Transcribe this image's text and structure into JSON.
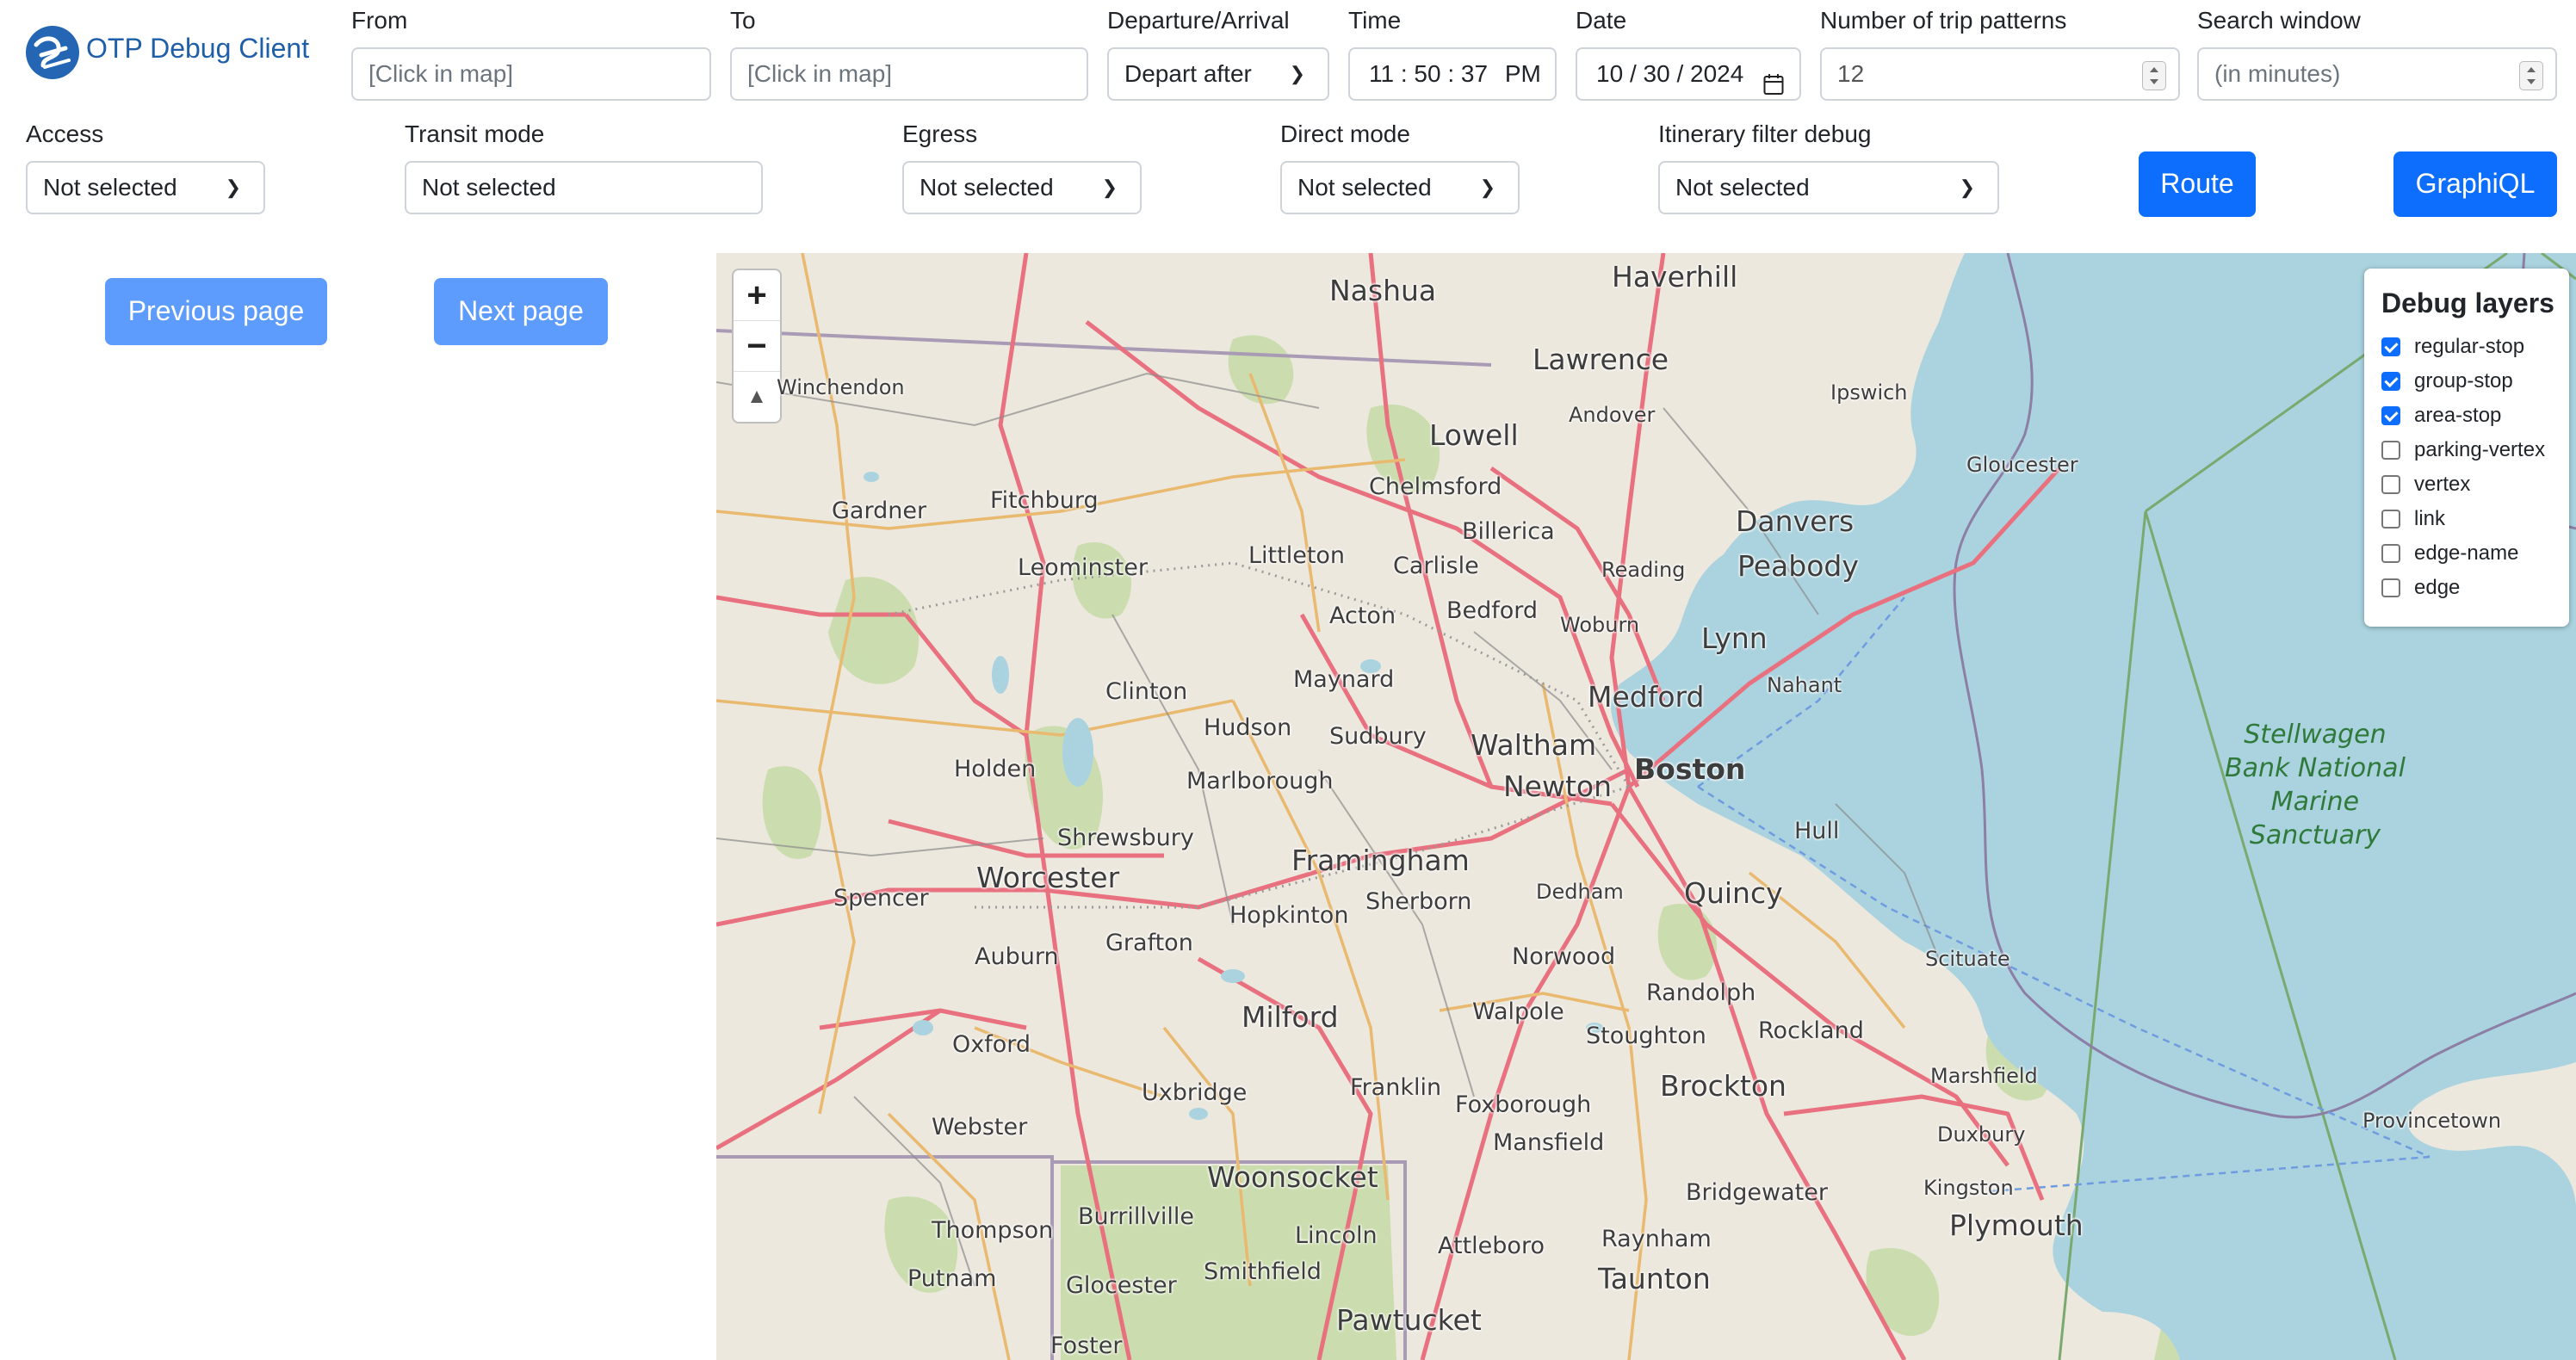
{
  "app": {
    "title": "OTP Debug Client"
  },
  "form": {
    "from": {
      "label": "From",
      "placeholder": "[Click in map]"
    },
    "to": {
      "label": "To",
      "placeholder": "[Click in map]"
    },
    "departure": {
      "label": "Departure/Arrival",
      "value": "Depart after"
    },
    "time": {
      "label": "Time",
      "hh": "11",
      "mm": "50",
      "ss": "37",
      "ampm": "PM"
    },
    "date": {
      "label": "Date",
      "month": "10",
      "day": "30",
      "year": "2024"
    },
    "num_patterns": {
      "label": "Number of trip patterns",
      "value": "12"
    },
    "search_window": {
      "label": "Search window",
      "placeholder": "(in minutes)"
    },
    "access": {
      "label": "Access",
      "value": "Not selected"
    },
    "transit": {
      "label": "Transit mode",
      "value": "Not selected"
    },
    "egress": {
      "label": "Egress",
      "value": "Not selected"
    },
    "direct": {
      "label": "Direct mode",
      "value": "Not selected"
    },
    "filter_debug": {
      "label": "Itinerary filter debug",
      "value": "Not selected"
    },
    "route_label": "Route",
    "graphiql_label": "GraphiQL"
  },
  "pagination": {
    "previous": "Previous page",
    "next": "Next page"
  },
  "map": {
    "zoom_in": "+",
    "zoom_out": "−",
    "compass": "▲",
    "sanctuary_lines": [
      "Stellwagen",
      "Bank National",
      "Marine",
      "Sanctuary"
    ],
    "places": [
      "Nashua",
      "Haverhill",
      "Lawrence",
      "Ipswich",
      "Andover",
      "Winchendon",
      "Lowell",
      "Gloucester",
      "Gardner",
      "Fitchburg",
      "Chelmsford",
      "Billerica",
      "Danvers",
      "Leominster",
      "Littleton",
      "Carlisle",
      "Reading",
      "Peabody",
      "Acton",
      "Bedford",
      "Woburn",
      "Lynn",
      "Maynard",
      "Nahant",
      "Clinton",
      "Hudson",
      "Sudbury",
      "Medford",
      "Holden",
      "Marlborough",
      "Waltham",
      "Boston",
      "Newton",
      "Shrewsbury",
      "Hull",
      "Framingham",
      "Worcester",
      "Dedham",
      "Quincy",
      "Spencer",
      "Sherborn",
      "Hopkinton",
      "Grafton",
      "Auburn",
      "Norwood",
      "Scituate",
      "Randolph",
      "Walpole",
      "Milford",
      "Oxford",
      "Stoughton",
      "Rockland",
      "Franklin",
      "Marshfield",
      "Uxbridge",
      "Brockton",
      "Foxborough",
      "Webster",
      "Mansfield",
      "Duxbury",
      "Provincetown",
      "Woonsocket",
      "Kingston",
      "Bridgewater",
      "Burrillville",
      "Thompson",
      "Lincoln",
      "Plymouth",
      "Raynham",
      "Attleboro",
      "Smithfield",
      "Putnam",
      "Taunton",
      "Glocester",
      "Pawtucket",
      "Foster"
    ]
  },
  "debug_layers": {
    "title": "Debug layers",
    "items": [
      {
        "label": "regular-stop",
        "checked": true
      },
      {
        "label": "group-stop",
        "checked": true
      },
      {
        "label": "area-stop",
        "checked": true
      },
      {
        "label": "parking-vertex",
        "checked": false
      },
      {
        "label": "vertex",
        "checked": false
      },
      {
        "label": "link",
        "checked": false
      },
      {
        "label": "edge-name",
        "checked": false
      },
      {
        "label": "edge",
        "checked": false
      }
    ]
  },
  "colors": {
    "primary": "#0d6efd",
    "brand_text": "#1f5fa8",
    "water": "#aad3df",
    "land": "#ede8de",
    "major_road": "#e8707f",
    "park": "#bfd6a4"
  }
}
